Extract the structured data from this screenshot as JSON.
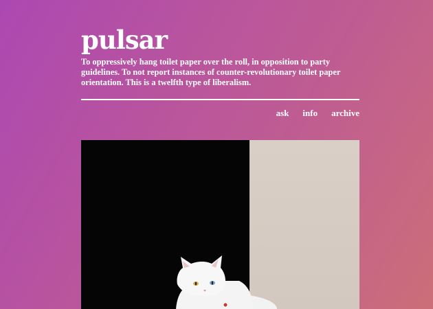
{
  "blog": {
    "title": "pulsar",
    "description": "To oppressively hang toilet paper over the roll, in opposition to party guidelines. To not report instances of counter-revolutionary toilet paper orientation. This is a twelfth type of liberalism."
  },
  "nav": {
    "ask": "ask",
    "info": "info",
    "archive": "archive"
  },
  "post": {
    "image_icon": "white-cat-photo"
  },
  "colors": {
    "text": "#ffffff",
    "bg_start": "#a446b4",
    "bg_end": "#cd6e78"
  }
}
